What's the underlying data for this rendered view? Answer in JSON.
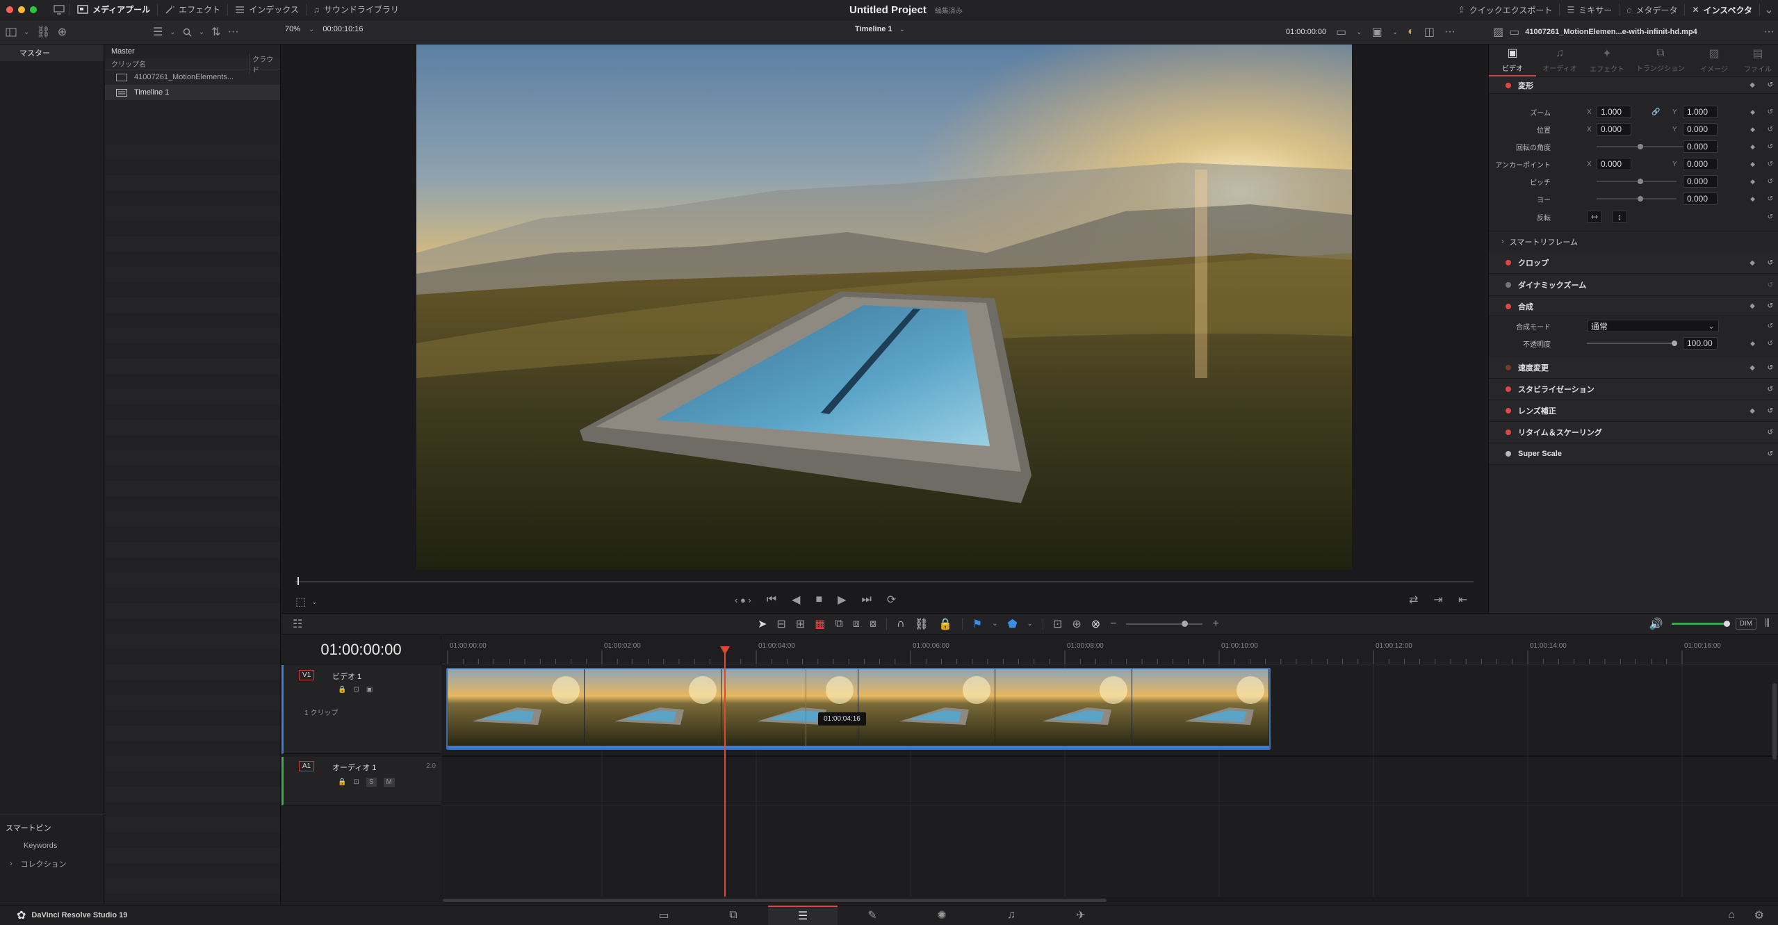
{
  "topbar": {
    "media_pool": "メディアプール",
    "effects": "エフェクト",
    "index": "インデックス",
    "sound_library": "サウンドライブラリ",
    "project_title": "Untitled Project",
    "project_status": "編集済み",
    "quick_export": "クイックエクスポート",
    "mixer": "ミキサー",
    "metadata": "メタデータ",
    "inspector": "インスペクタ"
  },
  "toolbar2": {
    "zoom": "70%",
    "timecode": "00:00:10:16",
    "timeline_name": "Timeline 1",
    "timecode_right": "01:00:00:00",
    "clip_name": "41007261_MotionElemen...e-with-infinit-hd.mp4"
  },
  "left": {
    "master": "マスター",
    "smart_bins": "スマートビン",
    "keywords": "Keywords",
    "collections": "コレクション"
  },
  "media": {
    "header": "Master",
    "col_clip": "クリップ名",
    "col_credit": "クラウド",
    "items": [
      "41007261_MotionElements...",
      "Timeline 1"
    ]
  },
  "inspector": {
    "tabs": [
      "ビデオ",
      "オーディオ",
      "エフェクト",
      "トランジション",
      "イメージ",
      "ファイル"
    ],
    "transform": "変形",
    "zoom_label": "ズーム",
    "zoom_x": "1.000",
    "zoom_y": "1.000",
    "pos_label": "位置",
    "pos_x": "0.000",
    "pos_y": "0.000",
    "rot_label": "回転の角度",
    "rot": "0.000",
    "anchor_label": "アンカーポイント",
    "anchor_x": "0.000",
    "anchor_y": "0.000",
    "pitch_label": "ピッチ",
    "pitch": "0.000",
    "yaw_label": "ヨー",
    "yaw": "0.000",
    "flip_label": "反転",
    "x": "X",
    "y": "Y",
    "smart_reframe": "スマートリフレーム",
    "crop": "クロップ",
    "dynamic_zoom": "ダイナミックズーム",
    "composite": "合成",
    "comp_mode_label": "合成モード",
    "comp_mode": "通常",
    "opacity_label": "不透明度",
    "opacity": "100.00",
    "speed": "速度変更",
    "stabilization": "スタビライゼーション",
    "lens": "レンズ補正",
    "retime": "リタイム＆スケーリング",
    "super_scale": "Super Scale"
  },
  "timeline": {
    "current_tc": "01:00:00:00",
    "ruler": [
      "01:00:00:00",
      "01:00:02:00",
      "01:00:04:00",
      "01:00:06:00",
      "01:00:08:00",
      "01:00:10:00",
      "01:00:12:00",
      "01:00:14:00",
      "01:00:16:00"
    ],
    "v1_tag": "V1",
    "v1_name": "ビデオ 1",
    "v1_clips": "1 クリップ",
    "a1_tag": "A1",
    "a1_name": "オーディオ 1",
    "a1_ch": "2.0",
    "hover_tc": "01:00:04:16",
    "dim": "DIM",
    "solo": "S",
    "mute": "M"
  },
  "status": {
    "app": "DaVinci Resolve Studio 19"
  }
}
